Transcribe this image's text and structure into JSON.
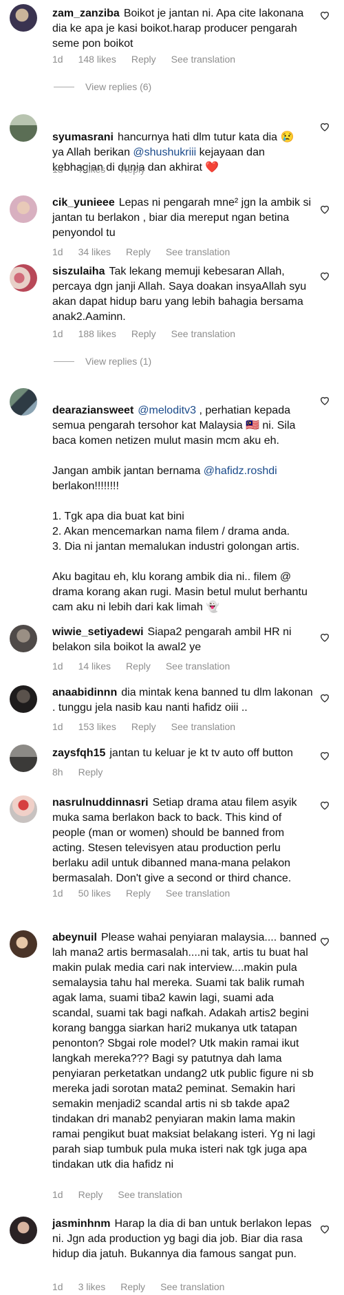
{
  "comments": [
    {
      "username": "zam_zanziba",
      "text": "Boikot je jantan ni. Apa cite lakonana dia ke apa je kasi boikot.harap producer pengarah seme pon boikot",
      "time": "1d",
      "likes": "148 likes",
      "reply": "Reply",
      "translate": "See translation",
      "view_replies": "View replies (6)"
    },
    {
      "username": "syumasrani",
      "text_pre": "hancurnya hati dlm tutur kata dia 😢\nya Allah berikan ",
      "mention": "@shushukriii",
      "text_post": " kejayaan dan kebhagian di dunia dan akhirat ❤️",
      "time": "1d",
      "likes": "7 likes",
      "reply": "Reply"
    },
    {
      "username": "cik_yunieee",
      "text": "Lepas ni pengarah mne² jgn la ambik si jantan tu berlakon , biar dia mereput ngan betina penyondol tu",
      "time": "1d",
      "likes": "34 likes",
      "reply": "Reply",
      "translate": "See translation"
    },
    {
      "username": "siszulaiha",
      "text": "Tak lekang memuji kebesaran Allah, percaya dgn janji Allah. Saya doakan insyaAllah syu akan dapat hidup baru yang lebih bahagia bersama anak2.Aaminn.",
      "time": "1d",
      "likes": "188 likes",
      "reply": "Reply",
      "translate": "See translation",
      "view_replies": "View replies (1)"
    },
    {
      "username": "dearaziansweet",
      "mention1": "@meloditv3",
      "text_a": " , perhatian kepada semua pengarah tersohor kat Malaysia 🇲🇾 ni. Sila baca komen netizen mulut masin mcm aku eh.\n\nJangan ambik jantan bernama ",
      "mention2": "@hafidz.roshdi",
      "text_b": "\nberlakon!!!!!!!!\n\n1. Tgk apa dia buat kat bini\n2. Akan mencemarkan nama filem / drama anda.\n3. Dia ni jantan memalukan industri golongan artis.\n\nAku bagitau eh, klu korang ambik dia ni.. filem @ drama korang akan rugi. Masin betul mulut berhantu cam aku ni lebih dari kak limah 👻"
    },
    {
      "username": "wiwie_setiyadewi",
      "text": "Siapa2 pengarah ambil HR ni belakon sila boikot la awal2 ye",
      "time": "1d",
      "likes": "14 likes",
      "reply": "Reply",
      "translate": "See translation"
    },
    {
      "username": "anaabidinnn",
      "text": "dia mintak kena banned tu dlm lakonan . tunggu jela nasib kau nanti hafidz oiii ..",
      "time": "1d",
      "likes": "153 likes",
      "reply": "Reply",
      "translate": "See translation"
    },
    {
      "username": "zaysfqh15",
      "text": "jantan tu keluar je kt tv auto off button",
      "time": "8h",
      "reply": "Reply"
    },
    {
      "username": "nasrulnuddinnasri",
      "text": "Setiap drama atau filem asyik muka sama berlakon back to back. This kind of people (man or women) should be banned from acting. Stesen televisyen atau production perlu berlaku adil untuk dibanned mana-mana pelakon bermasalah. Don't give a second or third chance.",
      "time": "1d",
      "likes": "50 likes",
      "reply": "Reply",
      "translate": "See translation"
    },
    {
      "username": "abeynuil",
      "text": "Please wahai penyiaran malaysia.... banned lah mana2 artis bermasalah....ni tak, artis tu buat hal makin pulak media cari nak interview....makin pula semalaysia tahu hal mereka. Suami tak balik rumah agak lama, suami tiba2 kawin lagi, suami ada scandal, suami tak bagi nafkah. Adakah artis2 begini korang bangga siarkan hari2 mukanya utk tatapan penonton? Sbgai role model? Utk makin ramai ikut langkah mereka??? Bagi sy patutnya dah lama penyiaran perketatkan undang2 utk public figure ni sb mereka jadi sorotan mata2 peminat. Semakin hari semakin menjadi2 scandal artis ni sb takde apa2 tindakan dri manab2 penyiaran makin lama makin ramai pengikut buat maksiat belakang isteri. Yg ni lagi parah siap tumbuk pula muka isteri nak tgk juga apa tindakan utk dia hafidz ni",
      "time": "1d",
      "reply": "Reply",
      "translate": "See translation"
    },
    {
      "username": "jasminhnm",
      "text": "Harap la dia di ban untuk berlakon lepas ni. Jgn ada production yg bagi dia job. Biar dia rasa hidup dia jatuh. Bukannya dia famous sangat pun.",
      "time": "1d",
      "likes": "3 likes",
      "reply": "Reply",
      "translate": "See translation"
    }
  ]
}
